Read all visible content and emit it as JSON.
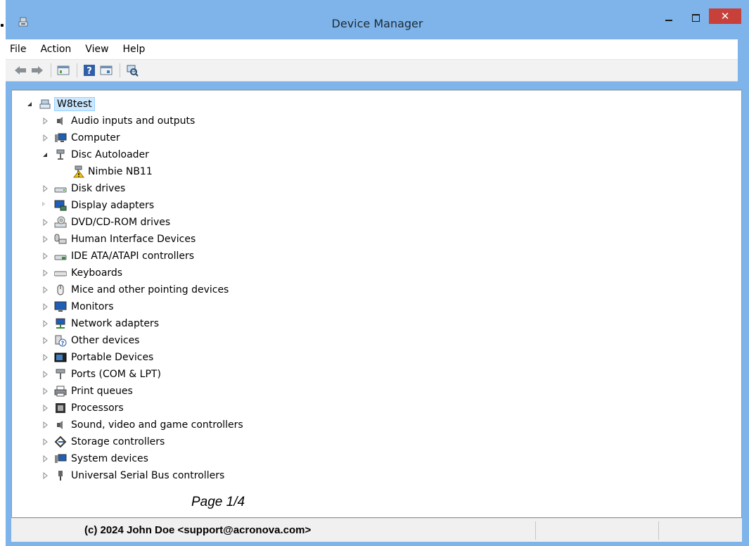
{
  "window": {
    "title": "Device Manager",
    "close_glyph": "✕"
  },
  "menu": [
    {
      "label": "File"
    },
    {
      "label": "Action"
    },
    {
      "label": "View"
    },
    {
      "label": "Help"
    }
  ],
  "toolbar": {
    "buttons": [
      "back-arrow-icon",
      "forward-arrow-icon",
      "properties-icon",
      "help-icon",
      "update-driver-icon",
      "scan-hardware-icon"
    ]
  },
  "tree": {
    "root": {
      "label": "W8test",
      "expanded": true
    },
    "categories": [
      {
        "label": "Audio inputs and outputs",
        "icon": "speaker-icon",
        "expanded": false
      },
      {
        "label": "Computer",
        "icon": "computer-icon",
        "expanded": false
      },
      {
        "label": "Disc Autoloader",
        "icon": "usb-plug-icon",
        "expanded": true,
        "children": [
          {
            "label": "Nimbie NB11",
            "icon": "warning-device-icon"
          }
        ]
      },
      {
        "label": "Disk drives",
        "icon": "disk-drive-icon",
        "expanded": false
      },
      {
        "label": "Display adapters",
        "icon": "display-adapter-icon",
        "expanded": false
      },
      {
        "label": "DVD/CD-ROM drives",
        "icon": "dvd-drive-icon",
        "expanded": false
      },
      {
        "label": "Human Interface Devices",
        "icon": "hid-icon",
        "expanded": false
      },
      {
        "label": "IDE ATA/ATAPI controllers",
        "icon": "ide-controller-icon",
        "expanded": false
      },
      {
        "label": "Keyboards",
        "icon": "keyboard-icon",
        "expanded": false
      },
      {
        "label": "Mice and other pointing devices",
        "icon": "mouse-icon",
        "expanded": false
      },
      {
        "label": "Monitors",
        "icon": "monitor-icon",
        "expanded": false
      },
      {
        "label": "Network adapters",
        "icon": "network-adapter-icon",
        "expanded": false
      },
      {
        "label": "Other devices",
        "icon": "unknown-device-icon",
        "expanded": false
      },
      {
        "label": "Portable Devices",
        "icon": "portable-device-icon",
        "expanded": false
      },
      {
        "label": "Ports (COM & LPT)",
        "icon": "port-icon",
        "expanded": false
      },
      {
        "label": "Print queues",
        "icon": "printer-icon",
        "expanded": false
      },
      {
        "label": "Processors",
        "icon": "processor-icon",
        "expanded": false
      },
      {
        "label": "Sound, video and game controllers",
        "icon": "sound-icon",
        "expanded": false
      },
      {
        "label": "Storage controllers",
        "icon": "storage-controller-icon",
        "expanded": false
      },
      {
        "label": "System devices",
        "icon": "system-device-icon",
        "expanded": false
      },
      {
        "label": "Universal Serial Bus controllers",
        "icon": "usb-icon",
        "expanded": false
      }
    ]
  },
  "page_label": "Page 1/4",
  "status": {
    "text": "(c) 2024 John Doe <support@acronova.com>"
  }
}
